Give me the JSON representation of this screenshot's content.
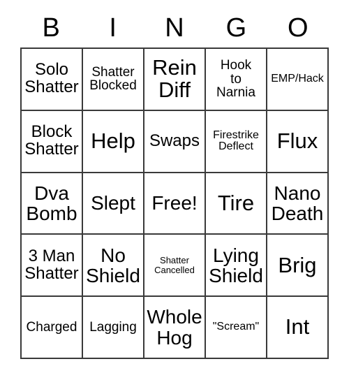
{
  "card": {
    "title_letters": [
      "B",
      "I",
      "N",
      "G",
      "O"
    ],
    "colors": {
      "border": "#3a3a3a",
      "cell_background": "#ffffff",
      "text": "#000000",
      "page_background": "#ffffff"
    },
    "grid_size": "5x5",
    "free_space": "Free!",
    "rows": [
      [
        {
          "text": "Solo\nShatter",
          "size": "md"
        },
        {
          "text": "Shatter\nBlocked",
          "size": "sm"
        },
        {
          "text": "Rein\nDiff",
          "size": "xl"
        },
        {
          "text": "Hook\nto\nNarnia",
          "size": "sm"
        },
        {
          "text": "EMP/Hack",
          "size": "xs"
        }
      ],
      [
        {
          "text": "Block\nShatter",
          "size": "md"
        },
        {
          "text": "Help",
          "size": "xl"
        },
        {
          "text": "Swaps",
          "size": "md"
        },
        {
          "text": "Firestrike\nDeflect",
          "size": "xs"
        },
        {
          "text": "Flux",
          "size": "xl"
        }
      ],
      [
        {
          "text": "Dva\nBomb",
          "size": "lg"
        },
        {
          "text": "Slept",
          "size": "lg"
        },
        {
          "text": "Free!",
          "size": "lg"
        },
        {
          "text": "Tire",
          "size": "xl"
        },
        {
          "text": "Nano\nDeath",
          "size": "lg"
        }
      ],
      [
        {
          "text": "3 Man\nShatter",
          "size": "md"
        },
        {
          "text": "No\nShield",
          "size": "lg"
        },
        {
          "text": "Shatter\nCancelled",
          "size": "xxs"
        },
        {
          "text": "Lying\nShield",
          "size": "lg"
        },
        {
          "text": "Brig",
          "size": "xl"
        }
      ],
      [
        {
          "text": "Charged",
          "size": "sm"
        },
        {
          "text": "Lagging",
          "size": "sm"
        },
        {
          "text": "Whole\nHog",
          "size": "lg"
        },
        {
          "text": "\"Scream\"",
          "size": "xs"
        },
        {
          "text": "Int",
          "size": "xl"
        }
      ]
    ]
  }
}
